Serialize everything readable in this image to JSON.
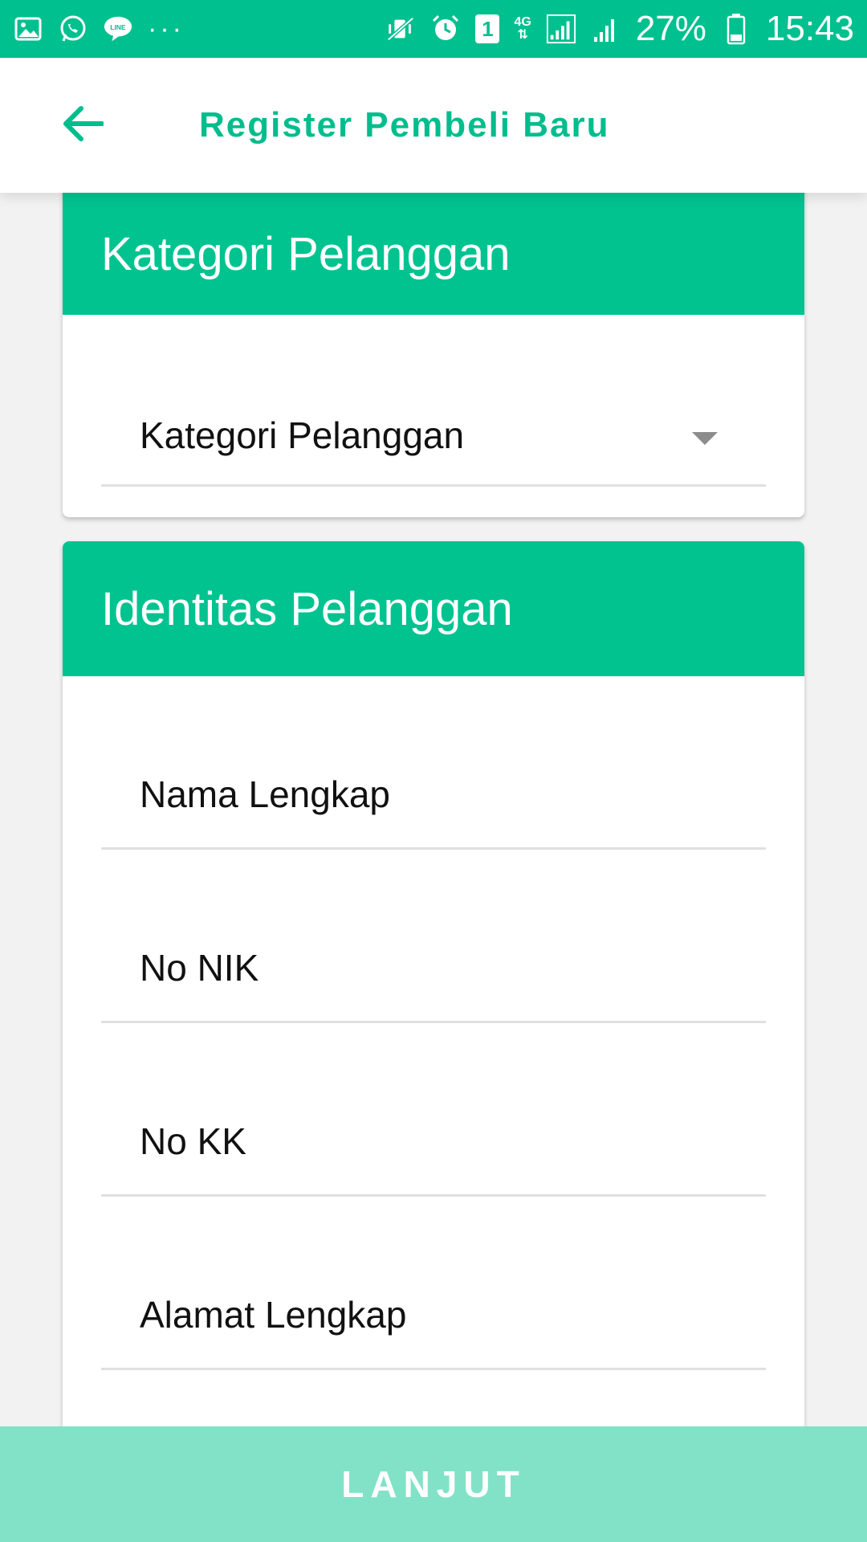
{
  "status_bar": {
    "icons_left": [
      "gallery-icon",
      "whatsapp-icon",
      "line-icon"
    ],
    "more": "···",
    "sim_label": "1",
    "network_label": "4G",
    "battery_percent": "27%",
    "time": "15:43"
  },
  "app_bar": {
    "title": "Register Pembeli Baru",
    "back_icon": "arrow-left-icon"
  },
  "kategori_card": {
    "header": "Kategori Pelanggan",
    "dropdown_label": "Kategori Pelanggan"
  },
  "identitas_card": {
    "header": "Identitas Pelanggan",
    "fields": [
      {
        "label": "Nama Lengkap"
      },
      {
        "label": "No NIK"
      },
      {
        "label": "No KK"
      },
      {
        "label": "Alamat Lengkap"
      }
    ]
  },
  "footer": {
    "next_label": "LANJUT"
  },
  "colors": {
    "primary": "#00c390",
    "status_bar": "#00c08f",
    "title_text": "#00bd8d",
    "button_disabled": "#82e2c8"
  }
}
